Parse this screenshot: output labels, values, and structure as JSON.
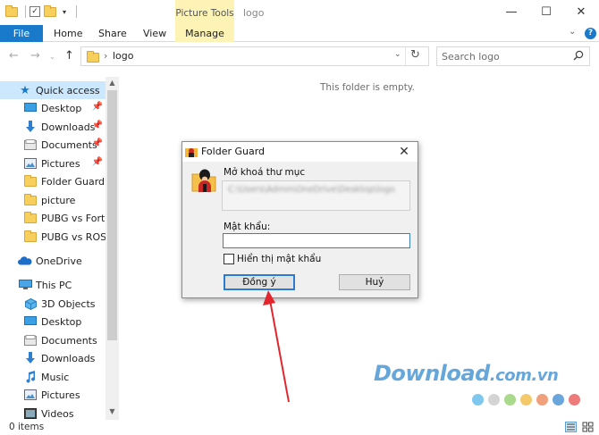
{
  "window": {
    "title": "logo",
    "context_tab": "Picture Tools",
    "minimize": "—",
    "maximize": "☐",
    "close": "✕"
  },
  "ribbon": {
    "file": "File",
    "tabs": [
      "Home",
      "Share",
      "View"
    ],
    "manage": "Manage",
    "help": "?",
    "collapse": "⌄"
  },
  "address": {
    "path": "logo",
    "chevron": "›",
    "dropdown": "⌄",
    "refresh": "↻"
  },
  "search": {
    "placeholder": "Search logo"
  },
  "navpane": {
    "quick_access": "Quick access",
    "quick_items": [
      {
        "label": "Desktop",
        "pinned": true,
        "icon": "desktop-icon"
      },
      {
        "label": "Downloads",
        "pinned": true,
        "icon": "download-arrow-icon"
      },
      {
        "label": "Documents",
        "pinned": true,
        "icon": "documents-icon"
      },
      {
        "label": "Pictures",
        "pinned": true,
        "icon": "pictures-icon"
      },
      {
        "label": "Folder Guard SD",
        "pinned": false,
        "icon": "folder-icon"
      },
      {
        "label": "picture",
        "pinned": false,
        "icon": "folder-icon"
      },
      {
        "label": "PUBG vs Fortnite",
        "pinned": false,
        "icon": "folder-icon"
      },
      {
        "label": "PUBG vs ROS",
        "pinned": false,
        "icon": "folder-icon"
      }
    ],
    "onedrive": "OneDrive",
    "this_pc": "This PC",
    "pc_items": [
      {
        "label": "3D Objects",
        "icon": "3d-objects-icon"
      },
      {
        "label": "Desktop",
        "icon": "desktop-icon"
      },
      {
        "label": "Documents",
        "icon": "documents-icon"
      },
      {
        "label": "Downloads",
        "icon": "download-arrow-icon"
      },
      {
        "label": "Music",
        "icon": "music-note-icon"
      },
      {
        "label": "Pictures",
        "icon": "pictures-icon"
      },
      {
        "label": "Videos",
        "icon": "videos-icon"
      }
    ]
  },
  "main": {
    "empty_message": "This folder is empty."
  },
  "status": {
    "items": "0 items"
  },
  "dialog": {
    "title": "Folder Guard",
    "unlock_label": "Mở khoá thư mục",
    "path_value": "C:\\Users\\Admin\\OneDrive\\Desktop\\logo",
    "password_label": "Mật khẩu:",
    "password_value": "",
    "show_password_label": "Hiển thị mật khẩu",
    "show_password_checked": false,
    "ok_button": "Đồng ý",
    "cancel_button": "Huỷ"
  },
  "watermark": {
    "brand": "Download",
    "domain": ".com.vn",
    "dot_colors": [
      "#7ec8ef",
      "#d4d4d4",
      "#a9d98a",
      "#f4c96a",
      "#f0a07a",
      "#6aa6dc",
      "#ef7a7a"
    ]
  },
  "colors": {
    "accent": "#1979ca",
    "context_tab": "#fcf3b5",
    "selection": "#cce8ff",
    "annotation_arrow": "#e3262d"
  }
}
